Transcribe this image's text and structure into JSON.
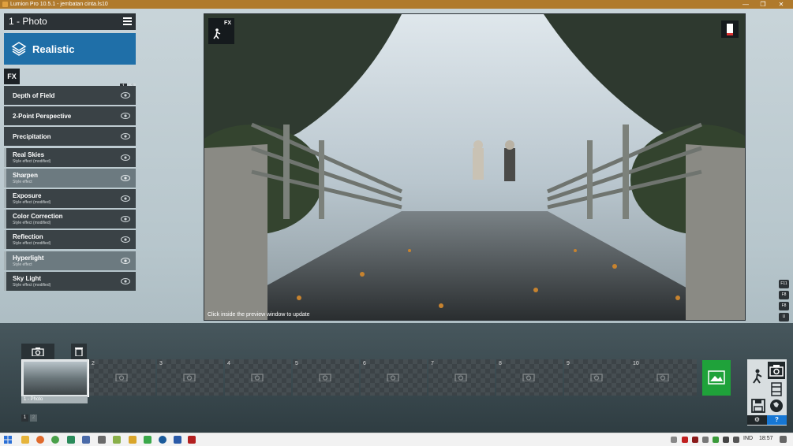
{
  "window": {
    "title": "Lumion Pro 10.5.1 - jembatan cinta.ls10",
    "minimize": "—",
    "maximize": "❐",
    "close": "✕"
  },
  "mode_header": {
    "label": "1 - Photo"
  },
  "style": {
    "label": "Realistic"
  },
  "fx_tag": "FX",
  "pages": [
    "1",
    "2"
  ],
  "effects": [
    {
      "name": "Depth of Field",
      "sub": ""
    },
    {
      "name": "2-Point Perspective",
      "sub": ""
    },
    {
      "name": "Precipitation",
      "sub": ""
    },
    {
      "name": "Real Skies",
      "sub": "Style effect (modified)"
    },
    {
      "name": "Sharpen",
      "sub": "Style effect"
    },
    {
      "name": "Exposure",
      "sub": "Style effect (modified)"
    },
    {
      "name": "Color Correction",
      "sub": "Style effect (modified)"
    },
    {
      "name": "Reflection",
      "sub": "Style effect (modified)"
    },
    {
      "name": "Hyperlight",
      "sub": "Style effect"
    },
    {
      "name": "Sky Light",
      "sub": "Style effect (modified)"
    }
  ],
  "preview": {
    "fx_badge": "FX",
    "hint": "Click inside the preview window to update"
  },
  "side_keys": [
    "F11",
    "F8",
    "F8",
    "U"
  ],
  "slots": [
    {
      "num": ""
    },
    {
      "num": "2"
    },
    {
      "num": "3"
    },
    {
      "num": "4"
    },
    {
      "num": "5"
    },
    {
      "num": "6"
    },
    {
      "num": "7"
    },
    {
      "num": "8"
    },
    {
      "num": "9"
    },
    {
      "num": "10"
    }
  ],
  "slot_caption": "1 - Photo",
  "slot_pages": [
    "1",
    "2"
  ],
  "mode_buttons": {
    "gear": "⚙",
    "help": "?"
  },
  "taskbar": {
    "lang": "IND",
    "time": "18:57"
  },
  "colors": {
    "titlebar": "#b07a2c",
    "style_button": "#1f6fa8",
    "render_button": "#1fa23a",
    "help_button": "#1677d4"
  }
}
